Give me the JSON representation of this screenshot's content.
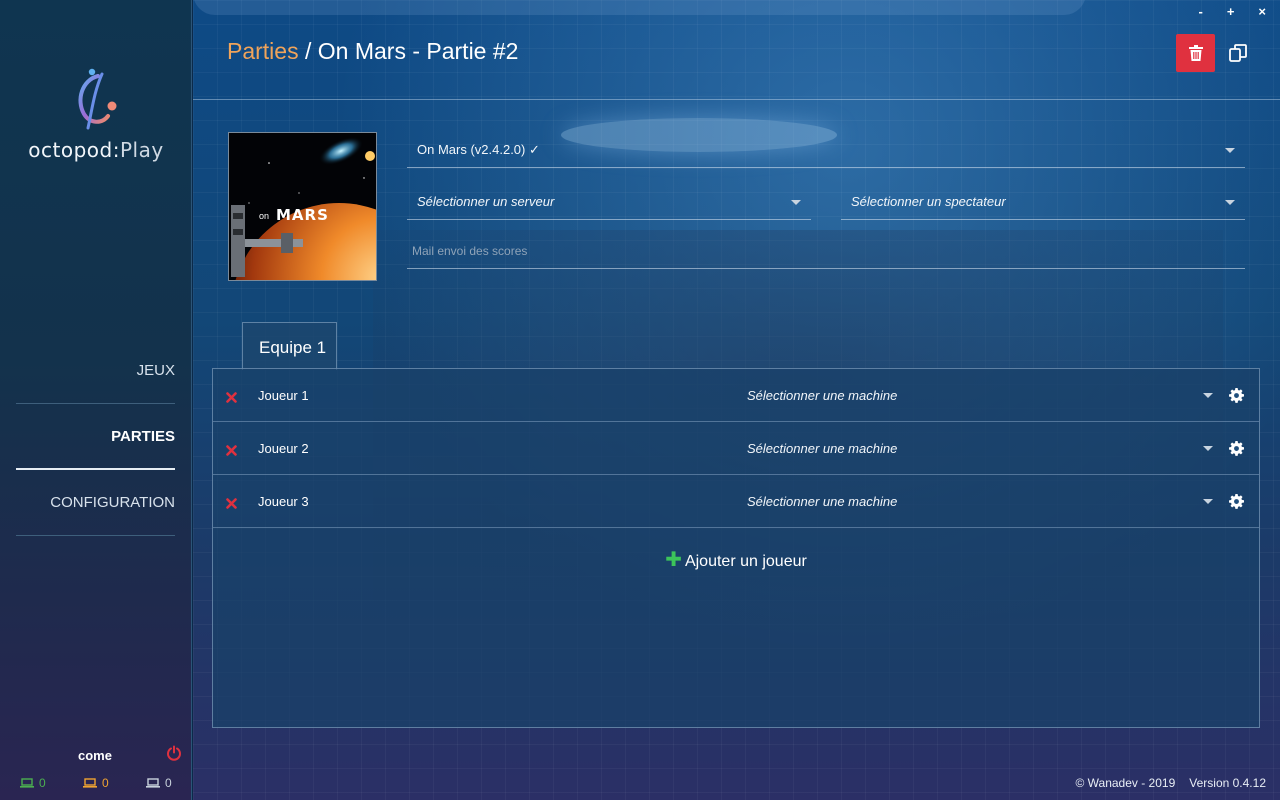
{
  "app": {
    "logo_main": "octopod",
    "logo_sep": ":",
    "logo_play": "Play"
  },
  "window": {
    "minimize": "-",
    "maximize": "+",
    "close": "×"
  },
  "sidebar": {
    "items": [
      {
        "label": "JEUX",
        "active": false
      },
      {
        "label": "PARTIES",
        "active": true
      },
      {
        "label": "CONFIGURATION",
        "active": false
      }
    ],
    "user": {
      "name": "come"
    },
    "status": {
      "green": "0",
      "orange": "0",
      "grey": "0"
    }
  },
  "header": {
    "crumb_link": "Parties",
    "crumb_sep": " / ",
    "crumb_current": "On Mars - Partie #2"
  },
  "game": {
    "cover_on": "on",
    "cover_title": "MARS",
    "selected_version": "On Mars (v2.4.2.0) ✓",
    "server_placeholder": "Sélectionner un serveur",
    "spectator_placeholder": "Sélectionner un spectateur",
    "mail_placeholder": "Mail envoi des scores"
  },
  "team": {
    "tab_label": "Equipe 1",
    "players": [
      {
        "name": "Joueur 1",
        "machine": "Sélectionner une machine"
      },
      {
        "name": "Joueur 2",
        "machine": "Sélectionner une machine"
      },
      {
        "name": "Joueur 3",
        "machine": "Sélectionner une machine"
      }
    ],
    "add_plus": "✚",
    "add_label": "Ajouter un joueur"
  },
  "footer": {
    "copyright": "© Wanadev - 2019",
    "version": "Version 0.4.12"
  },
  "colors": {
    "accent": "#f0a45a",
    "danger": "#e0313f",
    "success": "#3cc45a",
    "status_green": "#4caf50",
    "status_orange": "#f0a431"
  }
}
